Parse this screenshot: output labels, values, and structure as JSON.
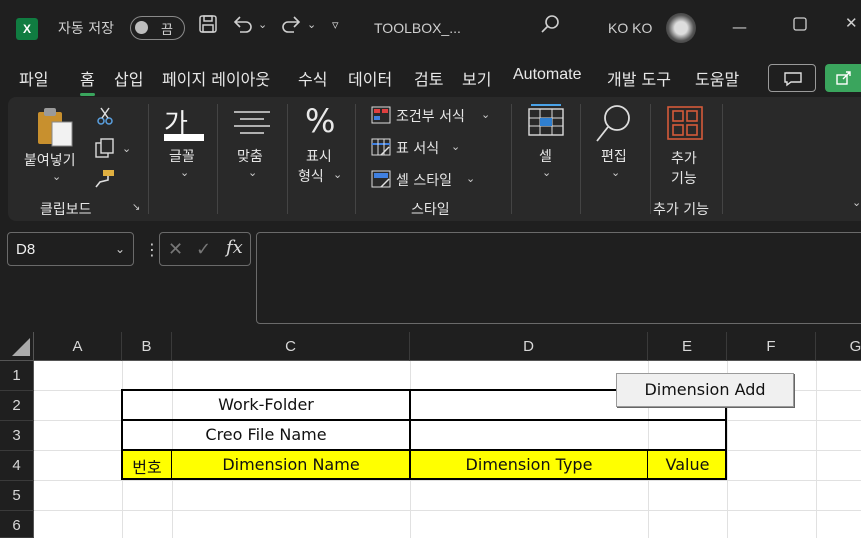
{
  "titlebar": {
    "autosave_label": "자동 저장",
    "autosave_state": "끔",
    "filename": "TOOLBOX_...",
    "user": "KO KO",
    "icons": [
      "save-icon",
      "undo-icon",
      "redo-icon",
      "customize-icon",
      "search-icon",
      "minimize-icon",
      "maximize-icon",
      "close-icon"
    ]
  },
  "tabs": [
    "파일",
    "홈",
    "삽입",
    "페이지 레이아웃",
    "수식",
    "데이터",
    "검토",
    "보기",
    "Automate",
    "개발 도구",
    "도움말"
  ],
  "active_tab": "홈",
  "ribbon": {
    "paste": "붙여넣기",
    "clipboard": "클립보드",
    "font": "글꼴",
    "align": "맞춤",
    "number_line1": "표시",
    "number_line2": "형식",
    "conditional": "조건부 서식",
    "table_format": "표 서식",
    "cell_style": "셀 스타일",
    "styles": "스타일",
    "cells": "셀",
    "editing": "편집",
    "addins_line1": "추가",
    "addins_line2": "기능",
    "addins_group": "추가 기능"
  },
  "formula_bar": {
    "name_box": "D8",
    "fx": "fx",
    "content": ""
  },
  "sheet": {
    "columns": [
      "A",
      "B",
      "C",
      "D",
      "E",
      "F",
      "G"
    ],
    "rows": [
      "1",
      "2",
      "3",
      "4",
      "5",
      "6"
    ],
    "c2": "Work-Folder",
    "c3": "Creo File Name",
    "b4": "번호",
    "c4": "Dimension Name",
    "d4": "Dimension Type",
    "e4": "Value",
    "button_label": "Dimension Add",
    "header_fill": "#ffff00"
  }
}
